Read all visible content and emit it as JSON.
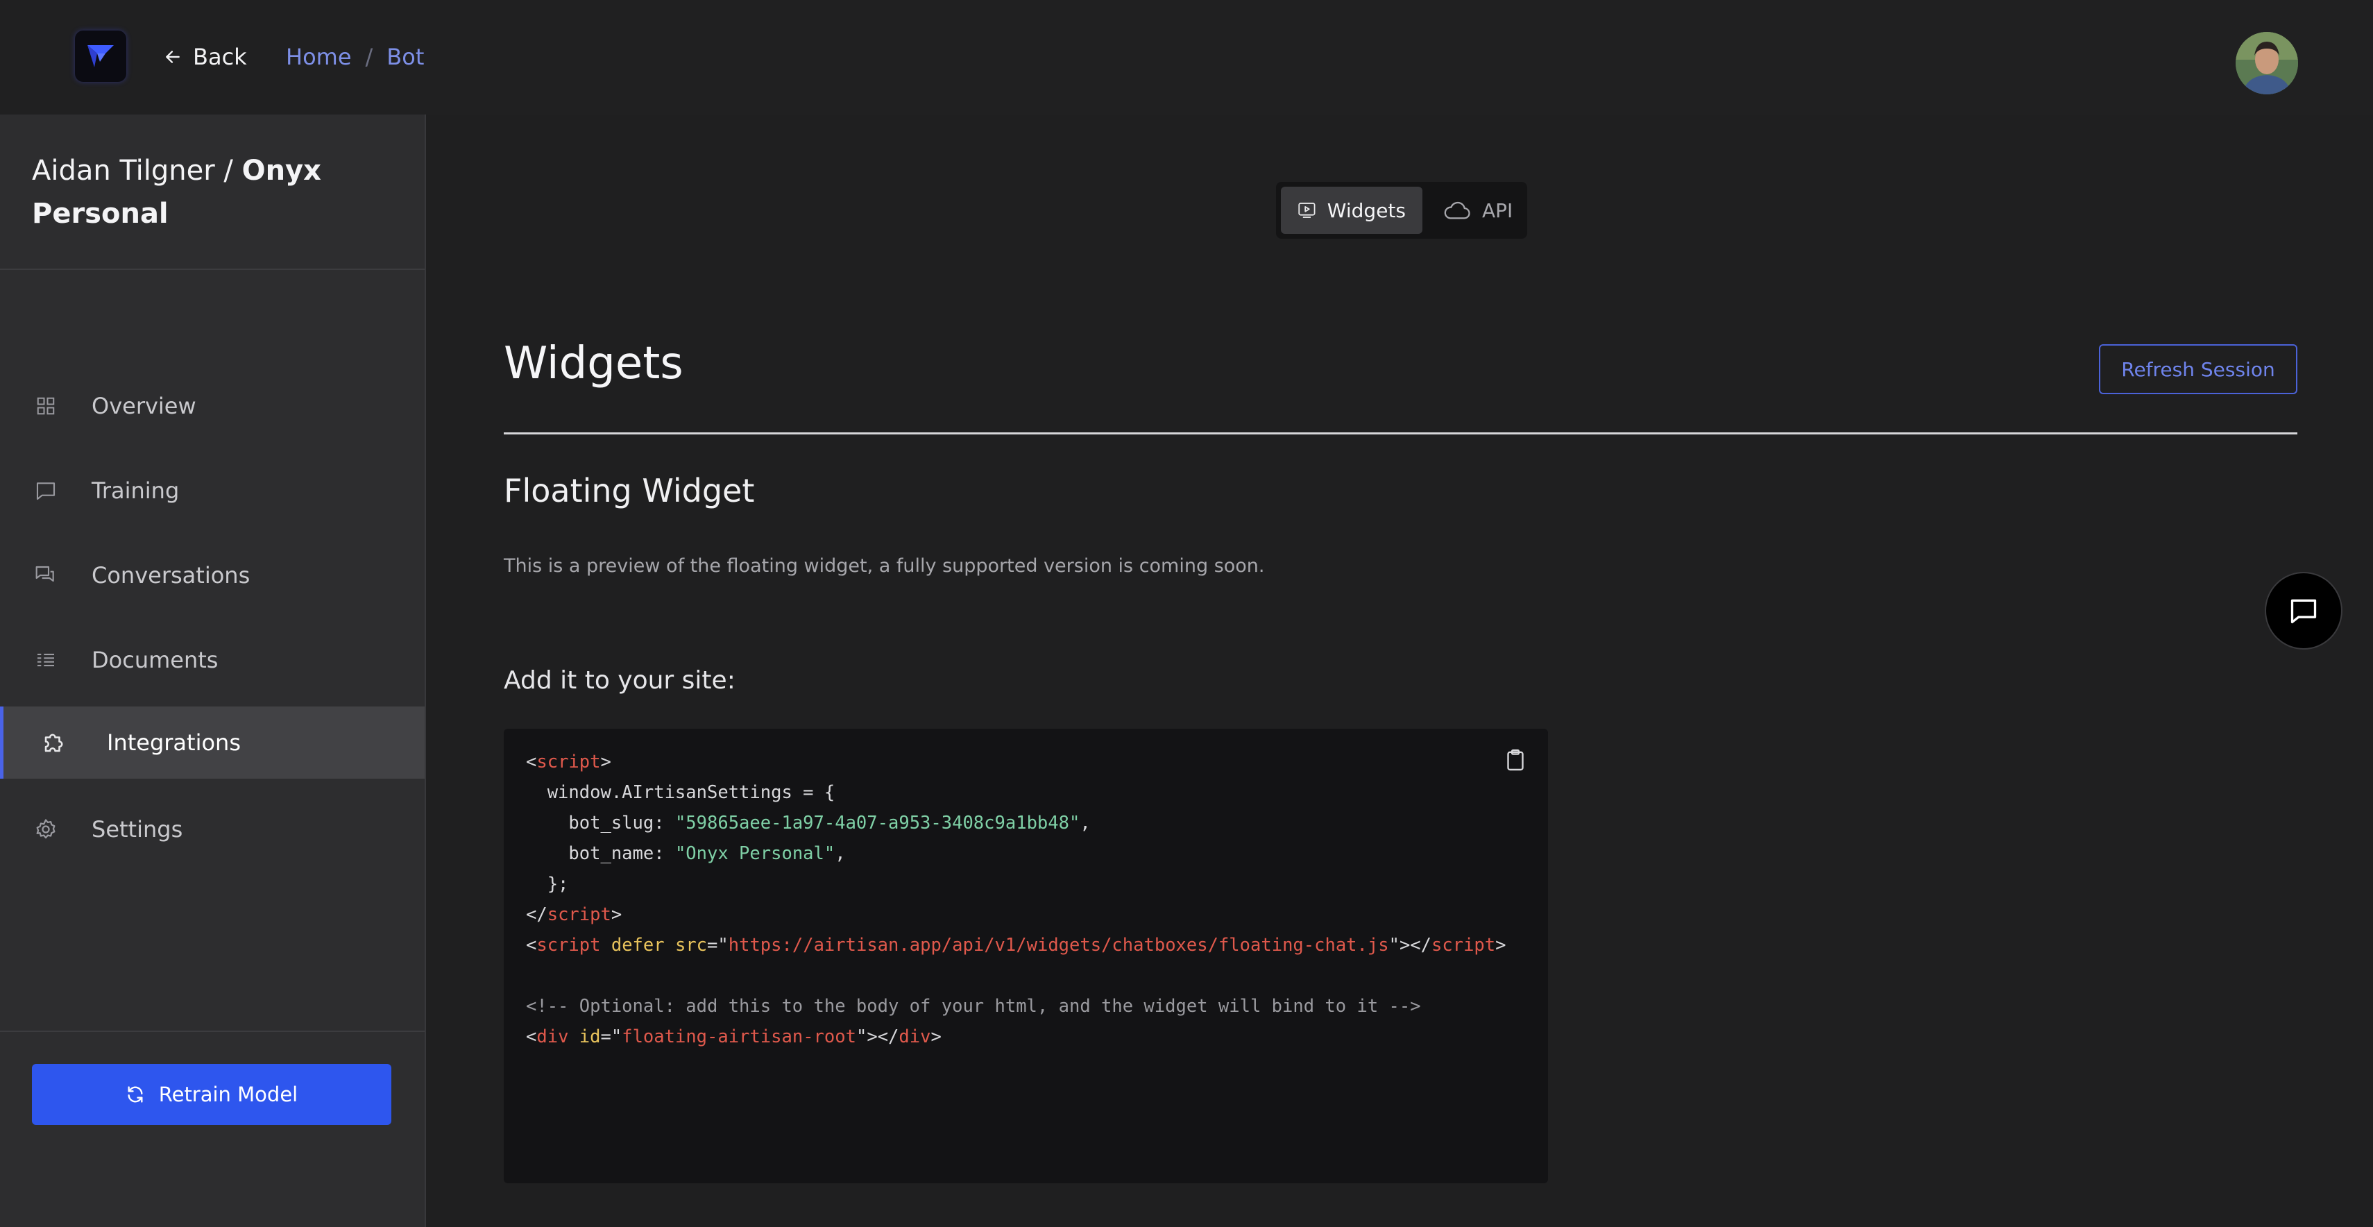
{
  "header": {
    "back_label": "Back",
    "breadcrumb": [
      "Home",
      "Bot"
    ],
    "breadcrumb_separator": "/"
  },
  "sidebar": {
    "owner": "Aidan Tilgner",
    "separator": " / ",
    "project": "Onyx Personal",
    "items": [
      {
        "label": "Overview",
        "icon": "grid-icon"
      },
      {
        "label": "Training",
        "icon": "message-square-icon"
      },
      {
        "label": "Conversations",
        "icon": "messages-icon"
      },
      {
        "label": "Documents",
        "icon": "list-icon"
      },
      {
        "label": "Integrations",
        "icon": "puzzle-icon",
        "active": true
      },
      {
        "label": "Settings",
        "icon": "gear-icon"
      }
    ],
    "retrain_label": "Retrain Model"
  },
  "tabs": [
    {
      "label": "Widgets",
      "icon": "video-icon",
      "active": true
    },
    {
      "label": "API",
      "icon": "cloud-icon",
      "active": false
    }
  ],
  "main": {
    "title": "Widgets",
    "refresh_label": "Refresh Session",
    "section_title": "Floating Widget",
    "section_desc": "This is a preview of the floating widget, a fully supported version is coming soon.",
    "add_title": "Add it to your site:"
  },
  "code": {
    "bot_slug": "\"59865aee-1a97-4a07-a953-3408c9a1bb48\"",
    "bot_name": "\"Onyx Personal\"",
    "script_src": "https://airtisan.app/api/v1/widgets/chatboxes/floating-chat.js",
    "comment": "<!-- Optional: add this to the body of your html, and the widget will bind to it -->",
    "root_id": "floating-airtisan-root"
  },
  "colors": {
    "accent": "#2e56ee",
    "link": "#7d8fe6",
    "active_border": "#4a63e8"
  }
}
